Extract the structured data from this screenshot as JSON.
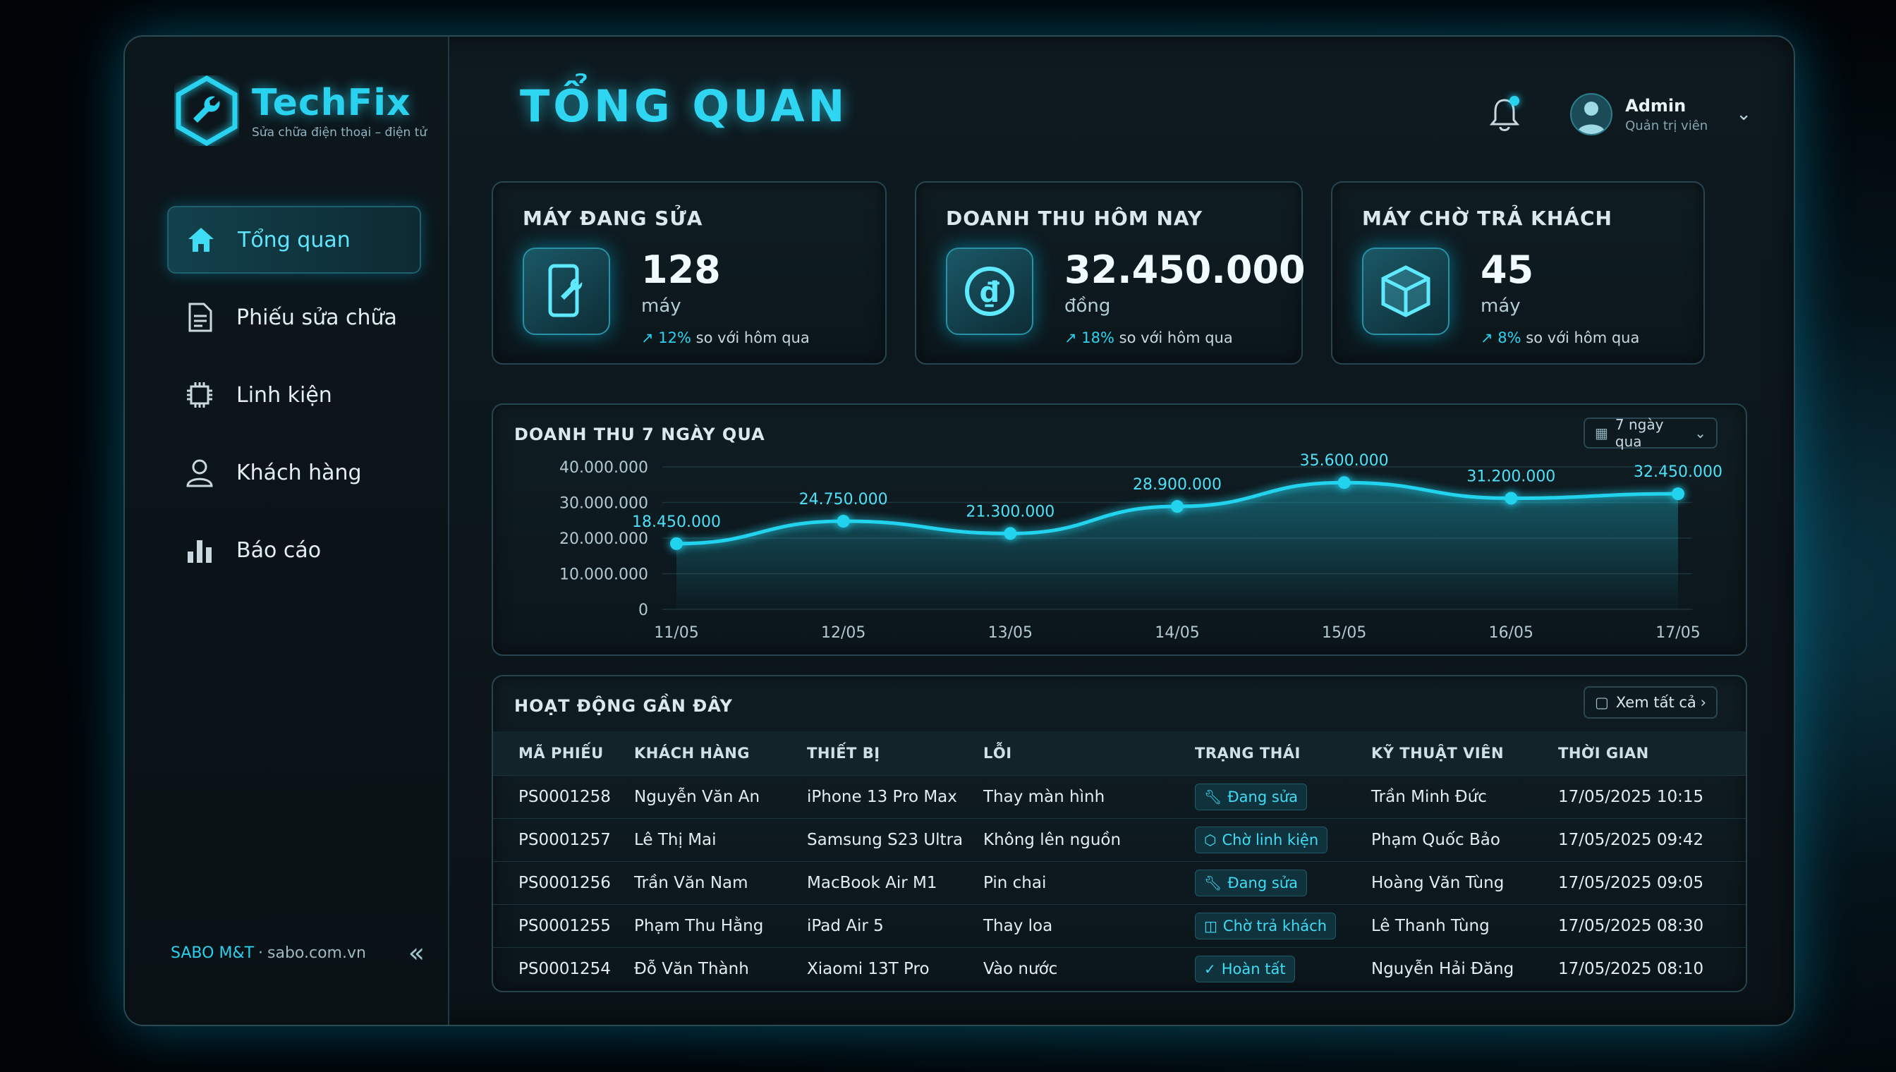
{
  "brand": {
    "name": "TechFix",
    "tagline": "Sửa chữa điện thoại – điện tử",
    "footer_brand": "SABO M&T",
    "footer_sep": "·",
    "footer_site": "sabo.com.vn"
  },
  "nav": {
    "items": [
      {
        "label": "Tổng quan",
        "icon": "home-icon",
        "active": true
      },
      {
        "label": "Phiếu sửa chữa",
        "icon": "document-icon",
        "active": false
      },
      {
        "label": "Linh kiện",
        "icon": "chip-icon",
        "active": false
      },
      {
        "label": "Khách hàng",
        "icon": "user-icon",
        "active": false
      },
      {
        "label": "Báo cáo",
        "icon": "bar-chart-icon",
        "active": false
      }
    ]
  },
  "header": {
    "title": "TỔNG QUAN",
    "user_name": "Admin",
    "user_role": "Quản trị viên"
  },
  "stats": [
    {
      "label": "MÁY ĐANG SỬA",
      "value": "128",
      "unit": "máy",
      "pct": "12%",
      "trend_text": "so với hôm qua",
      "icon": "phone-repair-icon"
    },
    {
      "label": "DOANH THU HÔM NAY",
      "value": "32.450.000",
      "unit": "đồng",
      "pct": "18%",
      "trend_text": "so với hôm qua",
      "icon": "coin-icon"
    },
    {
      "label": "MÁY CHỜ TRẢ KHÁCH",
      "value": "45",
      "unit": "máy",
      "pct": "8%",
      "trend_text": "so với hôm qua",
      "icon": "box-icon"
    }
  ],
  "chart": {
    "title": "DOANH THU 7 NGÀY QUA",
    "range_label": "7 ngày qua"
  },
  "chart_data": {
    "type": "area",
    "title": "DOANH THU 7 NGÀY QUA",
    "categories": [
      "11/05",
      "12/05",
      "13/05",
      "14/05",
      "15/05",
      "16/05",
      "17/05"
    ],
    "values": [
      18450000,
      24750000,
      21300000,
      28900000,
      35600000,
      31200000,
      32450000
    ],
    "value_labels": [
      "18.450.000",
      "24.750.000",
      "21.300.000",
      "28.900.000",
      "35.600.000",
      "31.200.000",
      "32.450.000"
    ],
    "yticks": [
      0,
      10000000,
      20000000,
      30000000,
      40000000
    ],
    "ytick_labels": [
      "0",
      "10.000.000",
      "20.000.000",
      "30.000.000",
      "40.000.000"
    ],
    "ylim": [
      0,
      40000000
    ],
    "color": "#22d3ee"
  },
  "activity": {
    "title": "HOẠT ĐỘNG GẦN ĐÂY",
    "view_all": "Xem tất cả",
    "columns": [
      "MÃ PHIẾU",
      "KHÁCH HÀNG",
      "THIẾT BỊ",
      "LỖI",
      "TRẠNG THÁI",
      "KỸ THUẬT VIÊN",
      "THỜI GIAN"
    ],
    "rows": [
      {
        "id": "PS0001258",
        "customer": "Nguyễn Văn An",
        "device": "iPhone 13 Pro Max",
        "issue": "Thay màn hình",
        "status": "Đang sửa",
        "status_icon": "wrench-icon",
        "tech": "Trần Minh Đức",
        "time": "17/05/2025 10:15"
      },
      {
        "id": "PS0001257",
        "customer": "Lê Thị Mai",
        "device": "Samsung S23 Ultra",
        "issue": "Không lên nguồn",
        "status": "Chờ linh kiện",
        "status_icon": "package-icon",
        "tech": "Phạm Quốc Bảo",
        "time": "17/05/2025 09:42"
      },
      {
        "id": "PS0001256",
        "customer": "Trần Văn Nam",
        "device": "MacBook Air M1",
        "issue": "Pin chai",
        "status": "Đang sửa",
        "status_icon": "wrench-icon",
        "tech": "Hoàng Văn Tùng",
        "time": "17/05/2025 09:05"
      },
      {
        "id": "PS0001255",
        "customer": "Phạm Thu Hằng",
        "device": "iPad Air 5",
        "issue": "Thay loa",
        "status": "Chờ trả khách",
        "status_icon": "bag-icon",
        "tech": "Lê Thanh Tùng",
        "time": "17/05/2025 08:30"
      },
      {
        "id": "PS0001254",
        "customer": "Đỗ Văn Thành",
        "device": "Xiaomi 13T Pro",
        "issue": "Vào nước",
        "status": "Hoàn tất",
        "status_icon": "check-icon",
        "tech": "Nguyễn Hải Đăng",
        "time": "17/05/2025 08:10"
      }
    ]
  }
}
